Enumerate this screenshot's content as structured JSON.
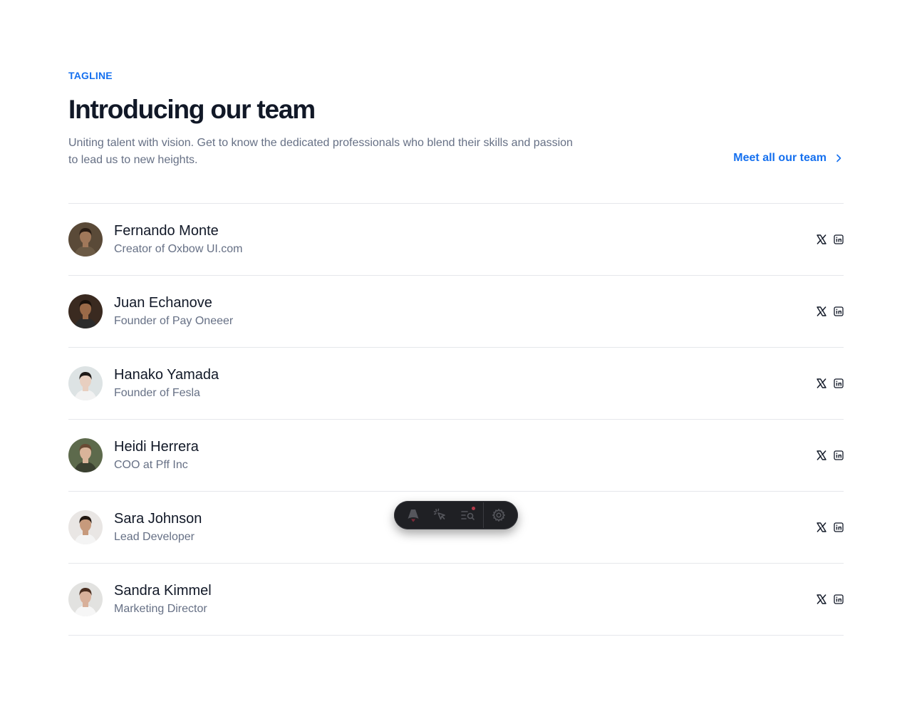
{
  "header": {
    "tagline": "TAGLINE",
    "title": "Introducing our team",
    "subtitle": "Uniting talent with vision. Get to know the dedicated professionals who blend their skills and passion to lead us to new heights.",
    "cta_label": "Meet all our team"
  },
  "team": [
    {
      "name": "Fernando Monte",
      "role": "Creator of Oxbow UI.com",
      "avatar_bg": "#5a4a38",
      "avatar_skin": "#a0785a",
      "avatar_hair": "#2a1d14",
      "avatar_shirt": "#6b5a45"
    },
    {
      "name": "Juan Echanove",
      "role": "Founder of Pay Oneeer",
      "avatar_bg": "#3a2a20",
      "avatar_skin": "#9a6a48",
      "avatar_hair": "#1a120c",
      "avatar_shirt": "#2b2b2b"
    },
    {
      "name": "Hanako Yamada",
      "role": "Founder of Fesla",
      "avatar_bg": "#dde3e4",
      "avatar_skin": "#e8cfc0",
      "avatar_hair": "#1e1a18",
      "avatar_shirt": "#f2f2f2"
    },
    {
      "name": "Heidi Herrera",
      "role": "COO at Pff Inc",
      "avatar_bg": "#5d6a4c",
      "avatar_skin": "#d9b49a",
      "avatar_hair": "#6a4a34",
      "avatar_shirt": "#3a4030"
    },
    {
      "name": "Sara Johnson",
      "role": "Lead Developer",
      "avatar_bg": "#e9e6e4",
      "avatar_skin": "#c79a7c",
      "avatar_hair": "#221812",
      "avatar_shirt": "#f4f4f4"
    },
    {
      "name": "Sandra Kimmel",
      "role": "Marketing Director",
      "avatar_bg": "#e2e2e0",
      "avatar_skin": "#d8b09a",
      "avatar_hair": "#4a2e20",
      "avatar_shirt": "#f6f6f6"
    }
  ],
  "social_icons": [
    "x-icon",
    "linkedin-icon"
  ],
  "toolbar": {
    "buttons": [
      "astro-icon",
      "inspect-icon",
      "audit-icon",
      "settings-icon"
    ]
  },
  "colors": {
    "accent": "#1570ef",
    "text": "#111827",
    "muted": "#667085",
    "divider": "#e5e7eb"
  }
}
